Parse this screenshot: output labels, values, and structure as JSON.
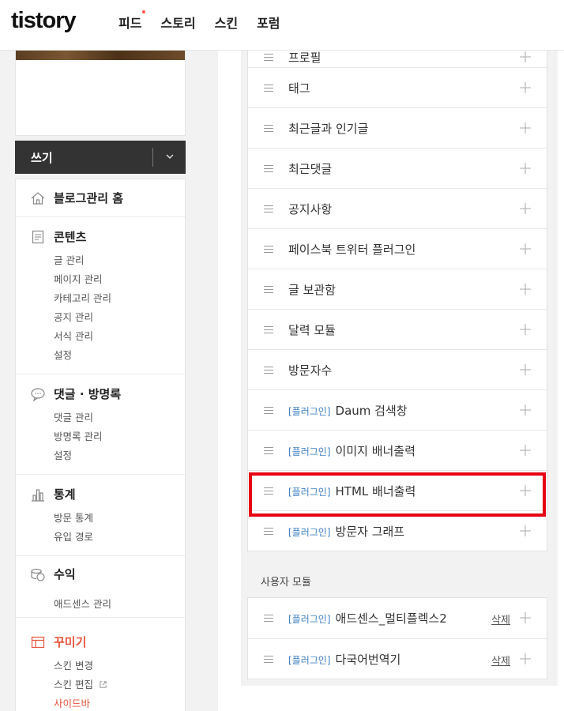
{
  "header": {
    "logo": "tistory",
    "nav": [
      {
        "label": "피드",
        "dot": true
      },
      {
        "label": "스토리",
        "dot": false
      },
      {
        "label": "스킨",
        "dot": false
      },
      {
        "label": "포럼",
        "dot": false
      }
    ]
  },
  "sidebar": {
    "write_label": "쓰기",
    "home": {
      "label": "블로그관리 홈",
      "icon": "home-icon"
    },
    "content": {
      "label": "콘텐츠",
      "icon": "document-icon",
      "items": [
        "글 관리",
        "페이지 관리",
        "카테고리 관리",
        "공지 관리",
        "서식 관리",
        "설정"
      ]
    },
    "comments": {
      "label": "댓글 · 방명록",
      "icon": "speech-bubble-icon",
      "items": [
        "댓글 관리",
        "방명록 관리",
        "설정"
      ]
    },
    "stats": {
      "label": "통계",
      "icon": "bar-chart-icon",
      "items": [
        "방문 통계",
        "유입 경로"
      ]
    },
    "revenue": {
      "label": "수익",
      "icon": "coins-icon",
      "items": [
        "애드센스 관리"
      ]
    },
    "decorate": {
      "label": "꾸미기",
      "icon": "layout-icon",
      "items": [
        "스킨 변경",
        "스킨 편집",
        "사이드바"
      ]
    }
  },
  "modules": {
    "partial_top": "프로필",
    "rows": [
      {
        "tag": "",
        "label": "태그"
      },
      {
        "tag": "",
        "label": "최근글과 인기글"
      },
      {
        "tag": "",
        "label": "최근댓글"
      },
      {
        "tag": "",
        "label": "공지사항"
      },
      {
        "tag": "",
        "label": "페이스북 트위터 플러그인"
      },
      {
        "tag": "",
        "label": "글 보관함"
      },
      {
        "tag": "",
        "label": "달력 모듈"
      },
      {
        "tag": "",
        "label": "방문자수"
      },
      {
        "tag": "[플러그인]",
        "label": "Daum 검색창"
      },
      {
        "tag": "[플러그인]",
        "label": "이미지 배너출력"
      },
      {
        "tag": "[플러그인]",
        "label": "HTML 배너출력"
      },
      {
        "tag": "[플러그인]",
        "label": "방문자 그래프"
      }
    ]
  },
  "user_modules": {
    "title": "사용자 모듈",
    "rows": [
      {
        "tag": "[플러그인]",
        "label": "애드센스_멀티플렉스2",
        "delete": "삭제"
      },
      {
        "tag": "[플러그인]",
        "label": "다국어번역기",
        "delete": "삭제"
      }
    ]
  },
  "colors": {
    "accent_red": "#e5533b",
    "highlight": "#e60012",
    "plugin_tag": "#3e7fc1",
    "write_button": "#333333"
  }
}
